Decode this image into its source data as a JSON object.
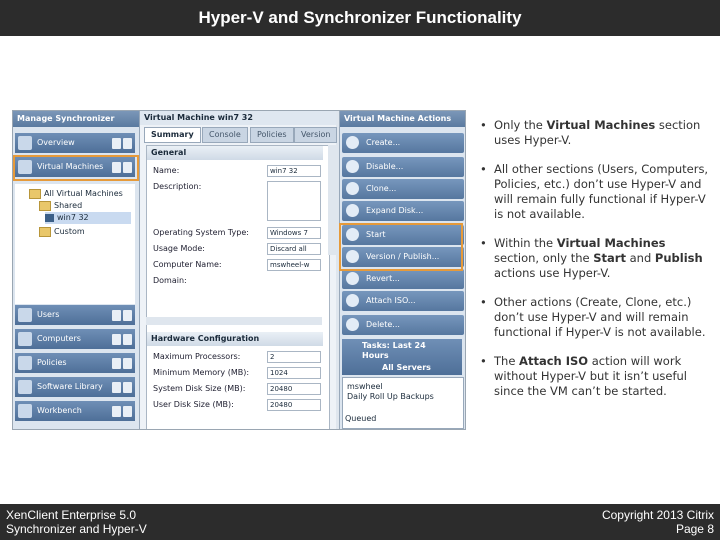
{
  "slide": {
    "title": "Hyper-V and Synchronizer Functionality",
    "footer_left_line1": "XenClient Enterprise 5.0",
    "footer_left_line2": "Synchronizer and Hyper-V",
    "footer_right_line1": "Copyright 2013 Citrix",
    "footer_right_line2": "Page 8",
    "highlight_color": "#e69a3a"
  },
  "left_nav": {
    "header": "Manage Synchronizer",
    "items": [
      {
        "label": "Overview"
      },
      {
        "label": "Virtual Machines"
      }
    ],
    "tree": [
      {
        "label": "All Virtual Machines"
      },
      {
        "label": "Shared"
      },
      {
        "label": "win7 32"
      },
      {
        "label": "Custom"
      }
    ],
    "bottom_items": [
      {
        "label": "Users"
      },
      {
        "label": "Computers"
      },
      {
        "label": "Policies"
      },
      {
        "label": "Software Library"
      },
      {
        "label": "Workbench"
      }
    ]
  },
  "vm_panel": {
    "title": "Virtual Machine win7 32",
    "tabs": [
      "Summary",
      "Console",
      "Policies",
      "Version"
    ],
    "general": {
      "header": "General",
      "name_label": "Name:",
      "name_value": "win7 32",
      "description_label": "Description:",
      "os_label": "Operating System Type:",
      "os_value": "Windows 7",
      "usage_label": "Usage Mode:",
      "usage_value": "Discard all",
      "computer_label": "Computer Name:",
      "computer_value": "mswheel-w",
      "domain_label": "Domain:"
    },
    "hardware": {
      "header": "Hardware Configuration",
      "max_proc_label": "Maximum Processors:",
      "max_proc_value": "2",
      "min_mem_label": "Minimum Memory (MB):",
      "min_mem_value": "1024",
      "sys_disk_label": "System Disk Size (MB):",
      "sys_disk_value": "20480",
      "user_disk_label": "User Disk Size (MB):",
      "user_disk_value": "20480"
    }
  },
  "actions": {
    "header": "Virtual Machine Actions",
    "items": [
      {
        "label": "Create..."
      },
      {
        "label": "Disable..."
      },
      {
        "label": "Clone..."
      },
      {
        "label": "Expand Disk..."
      },
      {
        "label": "Start"
      },
      {
        "label": "Version / Publish..."
      },
      {
        "label": "Revert..."
      },
      {
        "label": "Attach ISO..."
      },
      {
        "label": "Delete..."
      }
    ],
    "tasks_title_1": "Tasks: Last 24",
    "tasks_title_2": "Hours",
    "tasks_filter": "All Servers",
    "queue_user": "mswheel",
    "queue_task": "Daily Roll Up Backups",
    "queue_status": "Queued"
  },
  "bullets": [
    {
      "pre": "Only the ",
      "bold": "Virtual Machines",
      "post": " section uses Hyper-V."
    },
    {
      "pre": "All other sections (Users, Computers, Policies, etc.) don’t use Hyper-V and will remain fully functional if Hyper-V is not available.",
      "bold": "",
      "post": ""
    },
    {
      "pre": "Within the ",
      "bold": "Virtual Machines",
      "post": " section, only the ",
      "bold2": "Start",
      "mid2": " and ",
      "bold3": "Publish",
      "post3": " actions use Hyper-V."
    },
    {
      "pre": "Other actions (Create, Clone, etc.) don’t use Hyper-V and will remain functional if Hyper-V is not available.",
      "bold": "",
      "post": ""
    },
    {
      "pre": "The ",
      "bold": "Attach ISO",
      "post": " action will work without Hyper-V but it isn’t useful since the VM can’t be started."
    }
  ]
}
